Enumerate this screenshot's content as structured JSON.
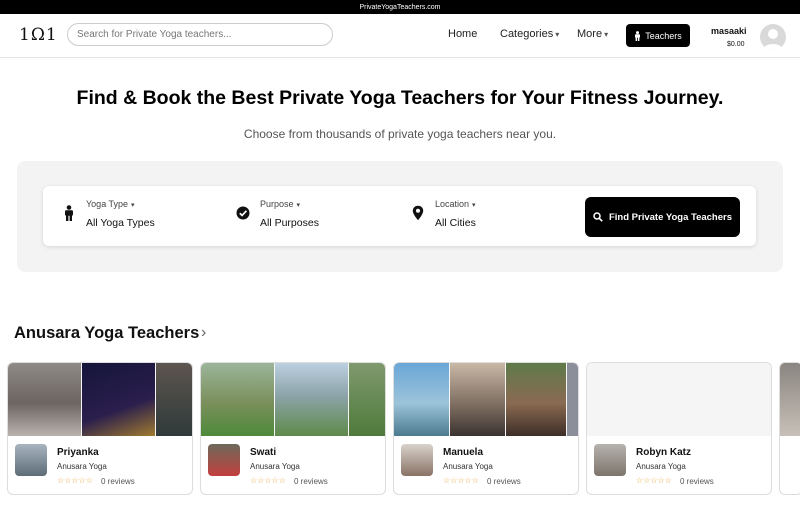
{
  "site_banner": "PrivateYogaTeachers.com",
  "header": {
    "logo": "1Ω1",
    "search_placeholder": "Search for Private Yoga teachers...",
    "nav": [
      {
        "label": "Home"
      },
      {
        "label": "Categories",
        "chevron": "▾"
      },
      {
        "label": "More",
        "chevron": "▾"
      }
    ],
    "teachers_button": "Teachers",
    "user": {
      "name": "masaaki",
      "balance": "$0.00"
    }
  },
  "hero": {
    "title": "Find & Book the Best Private Yoga Teachers for Your Fitness Journey.",
    "subtitle": "Choose from thousands of private yoga teachers near you."
  },
  "filters": [
    {
      "label": "Yoga Type",
      "value": "All Yoga Types",
      "icon": "person-icon"
    },
    {
      "label": "Purpose",
      "value": "All Purposes",
      "icon": "check-circle-icon"
    },
    {
      "label": "Location",
      "value": "All Cities",
      "icon": "location-pin-icon"
    }
  ],
  "find_button": "Find Private Yoga Teachers",
  "section": {
    "title": "Anusara Yoga Teachers",
    "arrow": "›"
  },
  "teachers": [
    {
      "name": "Priyanka",
      "style": "Anusara Yoga",
      "stars": "☆☆☆☆☆",
      "reviews": "0 reviews"
    },
    {
      "name": "Swati",
      "style": "Anusara Yoga",
      "stars": "☆☆☆☆☆",
      "reviews": "0 reviews"
    },
    {
      "name": "Manuela",
      "style": "Anusara Yoga",
      "stars": "☆☆☆☆☆",
      "reviews": "0 reviews"
    },
    {
      "name": "Robyn Katz",
      "style": "Anusara Yoga",
      "stars": "☆☆☆☆☆",
      "reviews": "0 reviews"
    }
  ],
  "colors": {
    "primary": "#000000",
    "star": "#e8a33a",
    "panel_bg": "#f3f3f3"
  }
}
